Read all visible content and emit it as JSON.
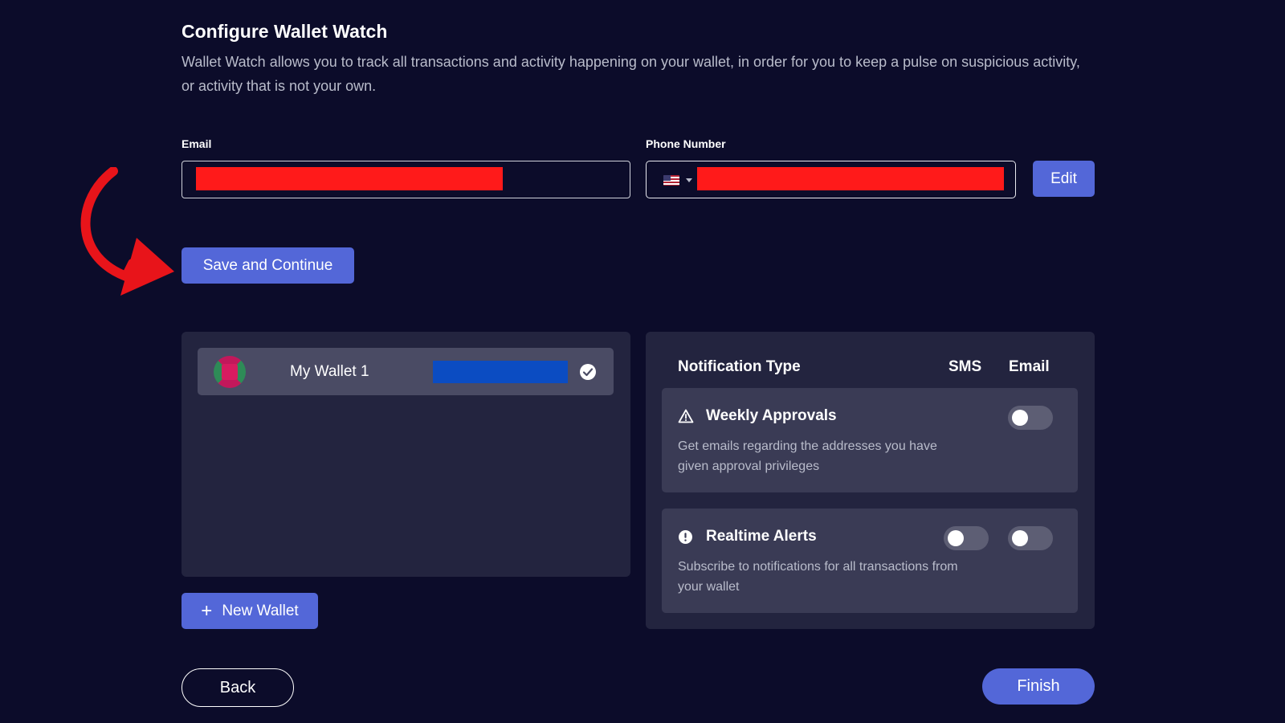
{
  "header": {
    "title": "Configure Wallet Watch",
    "description": "Wallet Watch allows you to track all transactions and activity happening on your wallet, in order for you to keep a pulse on suspicious activity, or activity that is not your own."
  },
  "form": {
    "email_label": "Email",
    "phone_label": "Phone Number",
    "country_flag": "us-flag-icon",
    "edit_label": "Edit",
    "save_label": "Save and Continue"
  },
  "wallets": {
    "items": [
      {
        "name": "My Wallet 1",
        "selected": true
      }
    ],
    "new_wallet_label": "New Wallet"
  },
  "notifications": {
    "headers": {
      "type": "Notification Type",
      "sms": "SMS",
      "email": "Email"
    },
    "items": [
      {
        "title": "Weekly Approvals",
        "icon": "warning-triangle-icon",
        "description": "Get emails regarding the addresses you have given approval privileges",
        "sms_enabled": null,
        "email_enabled": false
      },
      {
        "title": "Realtime Alerts",
        "icon": "alert-circle-icon",
        "description": "Subscribe to notifications for all transactions from your wallet",
        "sms_enabled": false,
        "email_enabled": false
      }
    ]
  },
  "footer": {
    "back_label": "Back",
    "finish_label": "Finish"
  },
  "colors": {
    "background": "#0c0c2a",
    "primary": "#5367d8",
    "panel": "#23243f",
    "card": "#3a3b55",
    "annotation_arrow": "#e8141a"
  }
}
